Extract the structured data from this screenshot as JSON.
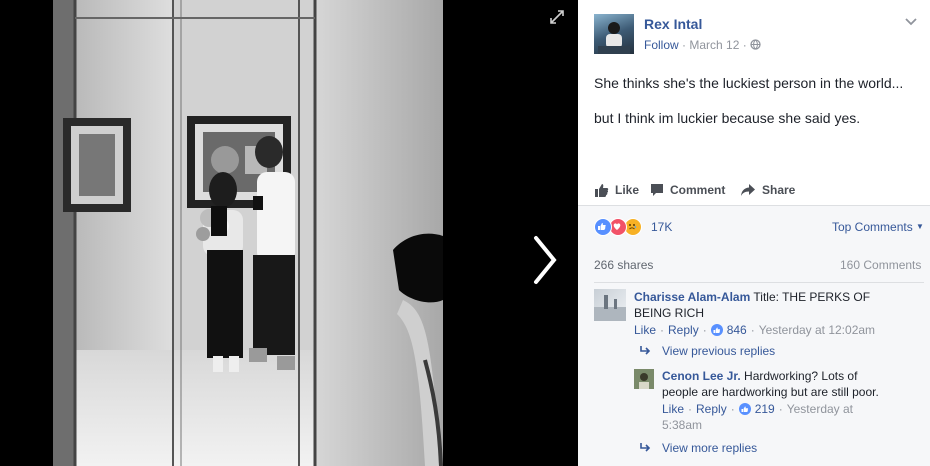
{
  "post": {
    "author": "Rex Intal",
    "follow_label": "Follow",
    "date": "March 12",
    "caption_lines": [
      "She thinks she's the luckiest person in the world...",
      "but I think im luckier because she said yes."
    ]
  },
  "actions": {
    "like": "Like",
    "comment": "Comment",
    "share": "Share"
  },
  "stats": {
    "reaction_count": "17K",
    "top_comments_label": "Top Comments",
    "shares": "266 shares",
    "comments": "160 Comments"
  },
  "comments": [
    {
      "author": "Charisse Alam-Alam",
      "text": "Title: THE PERKS OF",
      "text2": "BEING RICH",
      "like_label": "Like",
      "reply_label": "Reply",
      "likes": "846",
      "time": "Yesterday at 12:02am"
    }
  ],
  "view_previous_replies": "View previous replies",
  "reply": {
    "author": "Cenon Lee Jr.",
    "text": "Hardworking? Lots of",
    "text2": "people are hardworking but are still poor.",
    "like_label": "Like",
    "reply_label": "Reply",
    "likes": "219",
    "time": "Yesterday at",
    "time2": "5:38am"
  },
  "view_more_replies": "View more replies",
  "colors": {
    "link": "#365899",
    "like_blue": "#5890ff",
    "love_red": "#f25268",
    "sad_yellow": "#f7b125"
  }
}
